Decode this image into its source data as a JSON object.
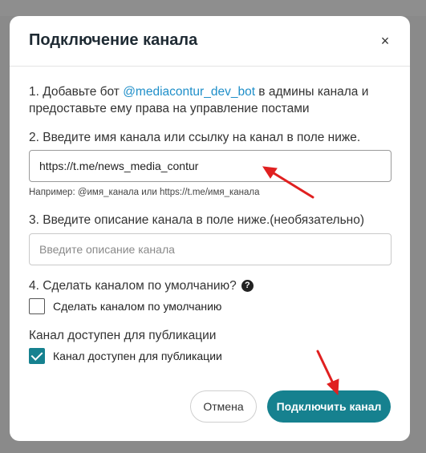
{
  "modal": {
    "title": "Подключение канала",
    "close_label": "×"
  },
  "step1": {
    "prefix": "1. Добавьте бот ",
    "bot_link": "@mediacontur_dev_bot",
    "suffix": " в админы канала и предоставьте ему права на управление постами"
  },
  "step2": {
    "label": "2. Введите имя канала или ссылку на канал в поле ниже.",
    "value": "https://t.me/news_media_contur",
    "hint": "Например: @имя_канала или https://t.me/имя_канала"
  },
  "step3": {
    "label": "3. Введите описание канала в поле ниже.(необязательно)",
    "placeholder": "Введите описание канала"
  },
  "step4": {
    "label": "4. Сделать каналом по умолчанию?",
    "help_icon": "?",
    "checkbox_label": "Сделать каналом по умолчанию",
    "checked": false
  },
  "availability": {
    "title": "Канал доступен для публикации",
    "checkbox_label": "Канал доступен для публикации",
    "checked": true
  },
  "buttons": {
    "cancel": "Отмена",
    "connect": "Подключить канал"
  },
  "colors": {
    "accent": "#16818f",
    "link": "#1f8fc9",
    "annotation_arrow": "#e02020"
  }
}
